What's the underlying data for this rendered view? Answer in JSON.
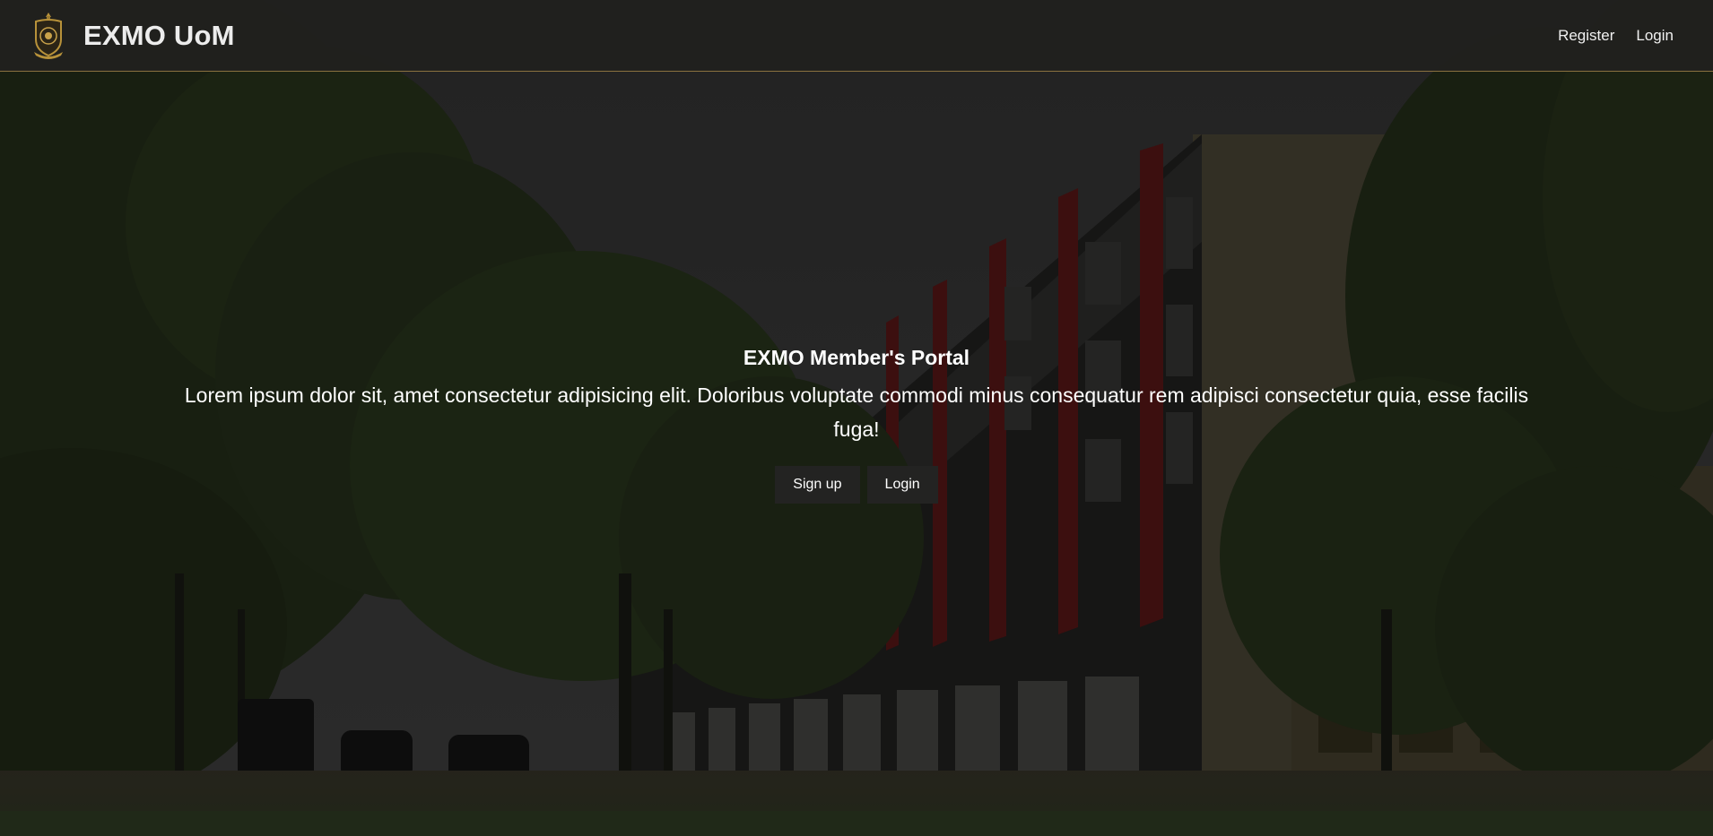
{
  "navbar": {
    "brand_title": "EXMO UoM",
    "links": {
      "register": "Register",
      "login": "Login"
    }
  },
  "hero": {
    "title": "EXMO Member's Portal",
    "text": "Lorem ipsum dolor sit, amet consectetur adipisicing elit. Doloribus voluptate commodi minus consequatur rem adipisci consectetur quia, esse facilis fuga!",
    "buttons": {
      "signup": "Sign up",
      "login": "Login"
    }
  },
  "colors": {
    "navbar_bg": "#20201e",
    "navbar_border": "#8a7140",
    "button_bg": "#232322",
    "text": "#ffffff",
    "crest_gold": "#b8923a"
  },
  "icons": {
    "brand_logo": "university-crest-icon"
  }
}
